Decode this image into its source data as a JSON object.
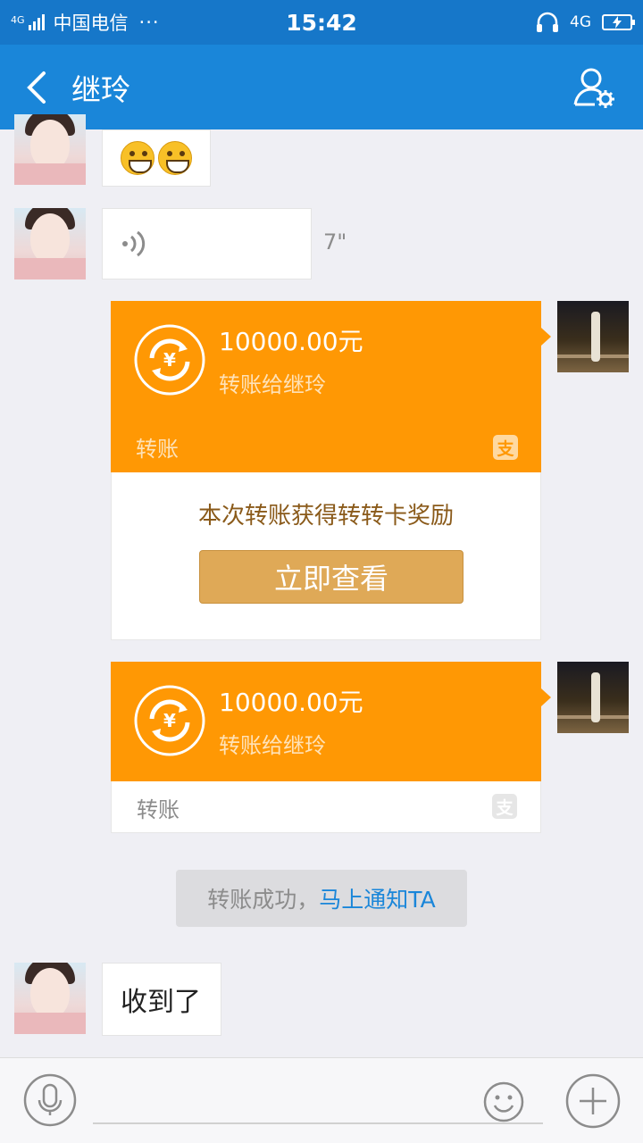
{
  "status_bar": {
    "signal_tag": "4G",
    "carrier": "中国电信",
    "more": "···",
    "time": "15:42",
    "network": "4G",
    "battery_icon": "charging-battery-icon"
  },
  "header": {
    "title": "继玲"
  },
  "messages": {
    "voice_duration": "7\"",
    "received_text": "收到了"
  },
  "transfer_1": {
    "amount": "10000.00元",
    "description": "转账给继玲",
    "label": "转账",
    "alipay_mark": "支",
    "reward_text": "本次转账获得转转卡奖励",
    "view_button": "立即查看"
  },
  "transfer_2": {
    "amount": "10000.00元",
    "description": "转账给继玲",
    "label": "转账",
    "alipay_mark": "支"
  },
  "notice": {
    "text": "转账成功，",
    "link": "马上通知TA"
  },
  "colors": {
    "header_blue": "#1a86d9",
    "status_blue": "#1677c9",
    "transfer_orange": "#ff9804",
    "view_button_gold": "#dfa957"
  }
}
